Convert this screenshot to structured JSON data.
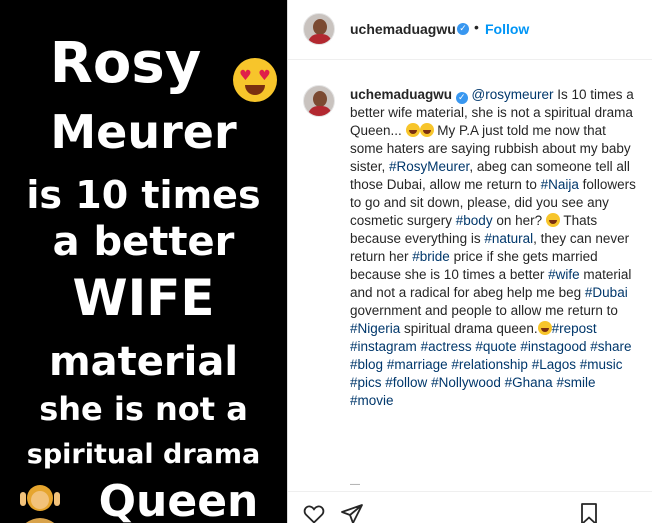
{
  "image": {
    "lines": [
      "Rosy",
      "Meurer",
      "is 10 times",
      "a better",
      "WIFE",
      "material",
      "she is not a",
      "spiritual drama",
      "Queen"
    ],
    "emojis": [
      "heart-eyes-emoji",
      "person-gesturing-emoji"
    ]
  },
  "post": {
    "username": "uchemaduagwu",
    "follow_label": "Follow",
    "separator": "•"
  },
  "caption": {
    "username": "uchemaduagwu",
    "mention": "@rosymeurer",
    "segments": [
      {
        "type": "text",
        "text": " Is 10 times a better wife material, she is not a spiritual drama Queen... "
      },
      {
        "type": "emoji",
        "name": "laughing-emoji"
      },
      {
        "type": "emoji",
        "name": "laughing-emoji"
      },
      {
        "type": "text",
        "text": " My P.A just told me now that some haters are saying rubbish about my baby sister, "
      },
      {
        "type": "tag",
        "text": "#RosyMeurer"
      },
      {
        "type": "text",
        "text": ", abeg can someone tell all those Dubai, allow me return to "
      },
      {
        "type": "tag",
        "text": "#Naija"
      },
      {
        "type": "text",
        "text": " followers to go and sit down, please, did you see any cosmetic surgery "
      },
      {
        "type": "tag",
        "text": "#body"
      },
      {
        "type": "text",
        "text": " on her? "
      },
      {
        "type": "emoji",
        "name": "laughing-emoji"
      },
      {
        "type": "text",
        "text": " Thats because everything is "
      },
      {
        "type": "tag",
        "text": "#natural"
      },
      {
        "type": "text",
        "text": ", they can never return her "
      },
      {
        "type": "tag",
        "text": "#bride"
      },
      {
        "type": "text",
        "text": " price if she gets married because she is 10 times a better "
      },
      {
        "type": "tag",
        "text": "#wife"
      },
      {
        "type": "text",
        "text": " material and not a radical for abeg help me beg "
      },
      {
        "type": "tag",
        "text": "#Dubai"
      },
      {
        "type": "text",
        "text": " government and people to allow me return to "
      },
      {
        "type": "tag",
        "text": "#Nigeria"
      },
      {
        "type": "text",
        "text": " spiritual drama queen."
      },
      {
        "type": "emoji",
        "name": "laughing-emoji"
      },
      {
        "type": "tag",
        "text": "#repost"
      },
      {
        "type": "text",
        "text": " "
      },
      {
        "type": "tag",
        "text": "#instagram"
      },
      {
        "type": "text",
        "text": " "
      },
      {
        "type": "tag",
        "text": "#actress"
      },
      {
        "type": "text",
        "text": " "
      },
      {
        "type": "tag",
        "text": "#quote"
      },
      {
        "type": "text",
        "text": " "
      },
      {
        "type": "tag",
        "text": "#instagood"
      },
      {
        "type": "text",
        "text": " "
      },
      {
        "type": "tag",
        "text": "#share"
      },
      {
        "type": "text",
        "text": " "
      },
      {
        "type": "tag",
        "text": "#blog"
      },
      {
        "type": "text",
        "text": " "
      },
      {
        "type": "tag",
        "text": "#marriage"
      },
      {
        "type": "text",
        "text": " "
      },
      {
        "type": "tag",
        "text": "#relationship"
      },
      {
        "type": "text",
        "text": " "
      },
      {
        "type": "tag",
        "text": "#Lagos"
      },
      {
        "type": "text",
        "text": " "
      },
      {
        "type": "tag",
        "text": "#music"
      },
      {
        "type": "text",
        "text": " "
      },
      {
        "type": "tag",
        "text": "#pics"
      },
      {
        "type": "text",
        "text": " "
      },
      {
        "type": "tag",
        "text": "#follow"
      },
      {
        "type": "text",
        "text": " "
      },
      {
        "type": "tag",
        "text": "#Nollywood"
      },
      {
        "type": "text",
        "text": " "
      },
      {
        "type": "tag",
        "text": "#Ghana"
      },
      {
        "type": "text",
        "text": " "
      },
      {
        "type": "tag",
        "text": "#smile"
      },
      {
        "type": "text",
        "text": " "
      },
      {
        "type": "tag",
        "text": "#movie"
      }
    ]
  },
  "actions": {
    "icons": [
      "heart-icon",
      "share-icon",
      "bookmark-icon"
    ]
  },
  "colors": {
    "link": "#00376b",
    "follow": "#0095f6",
    "verified": "#3897f0",
    "text": "#262626"
  }
}
